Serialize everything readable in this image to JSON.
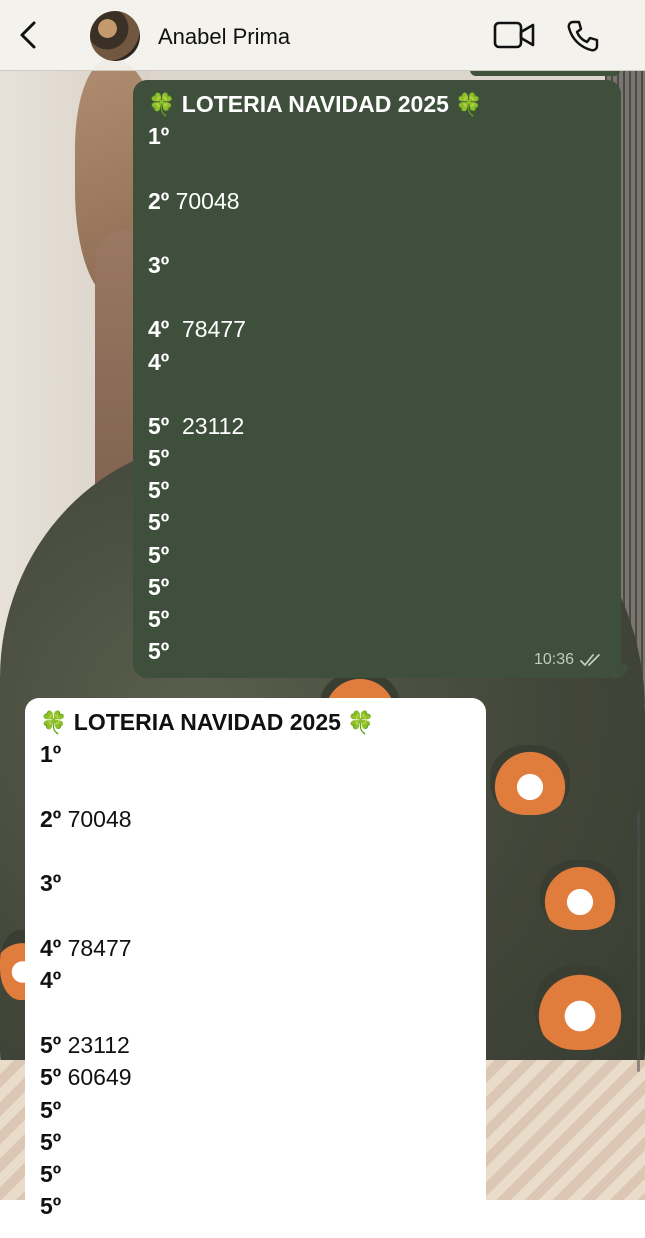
{
  "header": {
    "back_icon": "chevron-left-icon",
    "contact_name": "Anabel Prima",
    "video_icon": "video-camera-icon",
    "phone_icon": "phone-icon"
  },
  "messages": [
    {
      "direction": "outgoing",
      "title": "LOTERIA NAVIDAD 2025",
      "clover": "🍀",
      "lines": [
        {
          "rank": "1º",
          "number": ""
        },
        {
          "rank": "",
          "number": ""
        },
        {
          "rank": "2º",
          "number": " 70048"
        },
        {
          "rank": "",
          "number": ""
        },
        {
          "rank": "3º",
          "number": ""
        },
        {
          "rank": "",
          "number": ""
        },
        {
          "rank": "4º",
          "number": "  78477"
        },
        {
          "rank": "4º",
          "number": ""
        },
        {
          "rank": "",
          "number": ""
        },
        {
          "rank": "5º",
          "number": "  23112"
        },
        {
          "rank": "5º",
          "number": ""
        },
        {
          "rank": "5º",
          "number": ""
        },
        {
          "rank": "5º",
          "number": ""
        },
        {
          "rank": "5º",
          "number": ""
        },
        {
          "rank": "5º",
          "number": ""
        },
        {
          "rank": "5º",
          "number": ""
        },
        {
          "rank": "5º",
          "number": ""
        }
      ],
      "time": "10:36",
      "status_icon": "double-check-icon"
    },
    {
      "direction": "incoming",
      "title": "LOTERIA NAVIDAD 2025",
      "clover": "🍀",
      "lines": [
        {
          "rank": "1º",
          "number": ""
        },
        {
          "rank": "",
          "number": ""
        },
        {
          "rank": "2º",
          "number": " 70048"
        },
        {
          "rank": "",
          "number": ""
        },
        {
          "rank": "3º",
          "number": ""
        },
        {
          "rank": "",
          "number": ""
        },
        {
          "rank": "4º",
          "number": " 78477"
        },
        {
          "rank": "4º",
          "number": ""
        },
        {
          "rank": "",
          "number": ""
        },
        {
          "rank": "5º",
          "number": " 23112"
        },
        {
          "rank": "5º",
          "number": " 60649"
        },
        {
          "rank": "5º",
          "number": ""
        },
        {
          "rank": "5º",
          "number": ""
        },
        {
          "rank": "5º",
          "number": ""
        },
        {
          "rank": "5º",
          "number": ""
        }
      ]
    }
  ]
}
